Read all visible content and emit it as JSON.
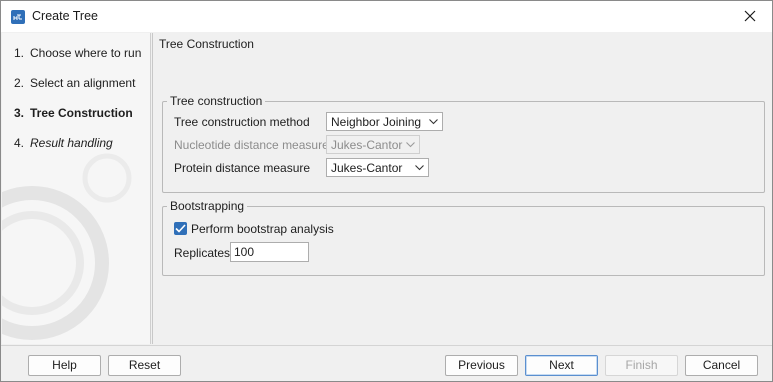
{
  "window": {
    "title": "Create Tree",
    "app_icon": "app-icon",
    "close_icon": "close-icon"
  },
  "steps": [
    {
      "num": "1.",
      "label": "Choose where to run",
      "state": "done"
    },
    {
      "num": "2.",
      "label": "Select an alignment",
      "state": "done"
    },
    {
      "num": "3.",
      "label": "Tree Construction",
      "state": "active"
    },
    {
      "num": "4.",
      "label": "Result handling",
      "state": "future"
    }
  ],
  "main": {
    "section_title": "Tree Construction",
    "tree_group": {
      "legend": "Tree construction",
      "method_label": "Tree construction method",
      "method_value": "Neighbor Joining",
      "nucleotide_label": "Nucleotide distance measure",
      "nucleotide_value": "Jukes-Cantor",
      "nucleotide_enabled": false,
      "protein_label": "Protein distance measure",
      "protein_value": "Jukes-Cantor"
    },
    "bootstrap_group": {
      "legend": "Bootstrapping",
      "perform_label": "Perform bootstrap analysis",
      "perform_checked": true,
      "replicates_label": "Replicates",
      "replicates_value": "100"
    }
  },
  "buttons": {
    "help": "Help",
    "reset": "Reset",
    "previous": "Previous",
    "next": "Next",
    "finish": "Finish",
    "cancel": "Cancel"
  },
  "colors": {
    "accent": "#2f6fb8",
    "disabled_text": "#8c8c8c"
  }
}
